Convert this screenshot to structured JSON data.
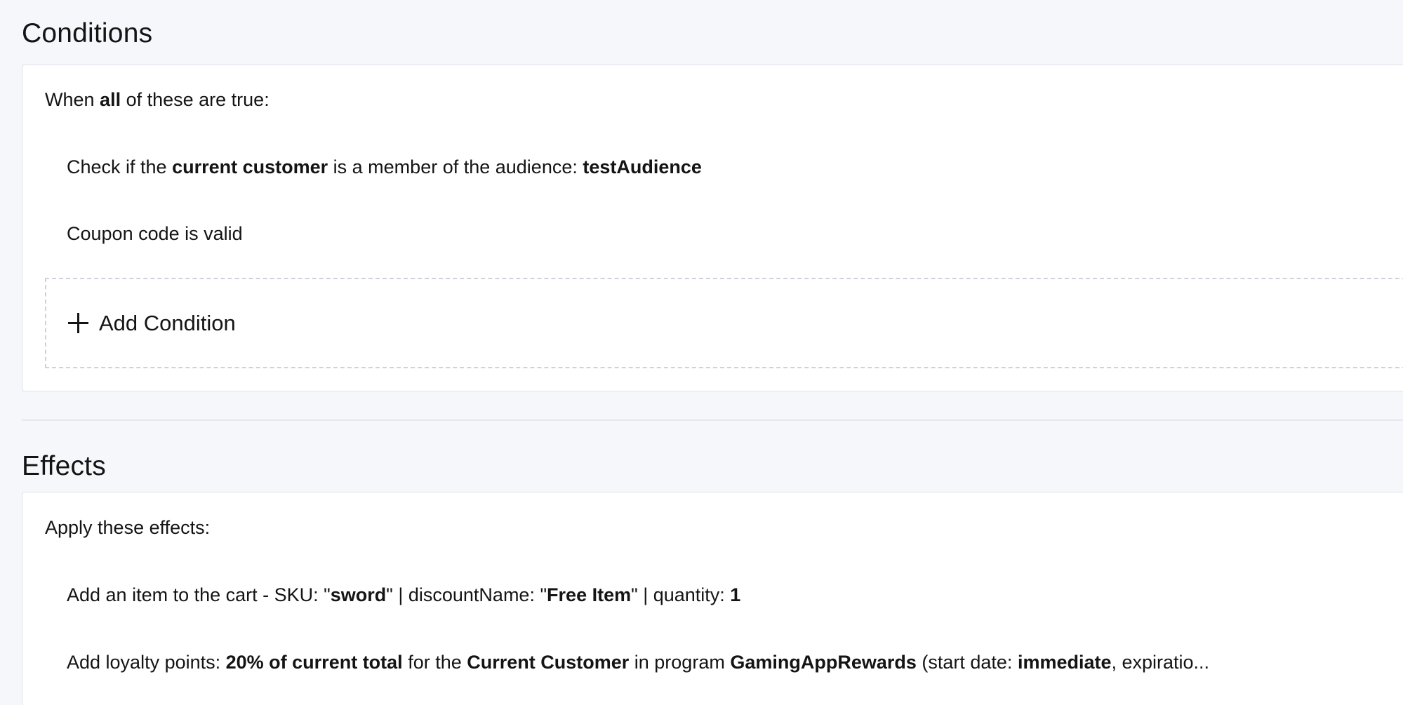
{
  "conditions": {
    "title": "Conditions",
    "header": {
      "prefix": "When ",
      "keyword": "all",
      "suffix": " of these are true:"
    },
    "items": [
      {
        "parts": [
          {
            "text": "Check if the ",
            "bold": false
          },
          {
            "text": "current customer",
            "bold": true
          },
          {
            "text": " is a member of the audience: ",
            "bold": false
          },
          {
            "text": "testAudience",
            "bold": true
          }
        ]
      },
      {
        "parts": [
          {
            "text": "Coupon code is valid",
            "bold": false
          }
        ]
      }
    ],
    "add_button_label": "Add Condition"
  },
  "effects": {
    "title": "Effects",
    "header": "Apply these effects:",
    "items": [
      {
        "parts": [
          {
            "text": "Add an item to the cart - SKU: \"",
            "bold": false
          },
          {
            "text": "sword",
            "bold": true
          },
          {
            "text": "\" | discountName: \"",
            "bold": false
          },
          {
            "text": "Free Item",
            "bold": true
          },
          {
            "text": "\" | quantity: ",
            "bold": false
          },
          {
            "text": "1",
            "bold": true
          }
        ]
      },
      {
        "parts": [
          {
            "text": "Add loyalty points: ",
            "bold": false
          },
          {
            "text": "20% of current total",
            "bold": true
          },
          {
            "text": " for the ",
            "bold": false
          },
          {
            "text": "Current Customer",
            "bold": true
          },
          {
            "text": " in program ",
            "bold": false
          },
          {
            "text": "GamingAppRewards",
            "bold": true
          },
          {
            "text": " (start date: ",
            "bold": false
          },
          {
            "text": "immediate",
            "bold": true
          },
          {
            "text": ", expiratio...",
            "bold": false
          }
        ]
      }
    ]
  }
}
